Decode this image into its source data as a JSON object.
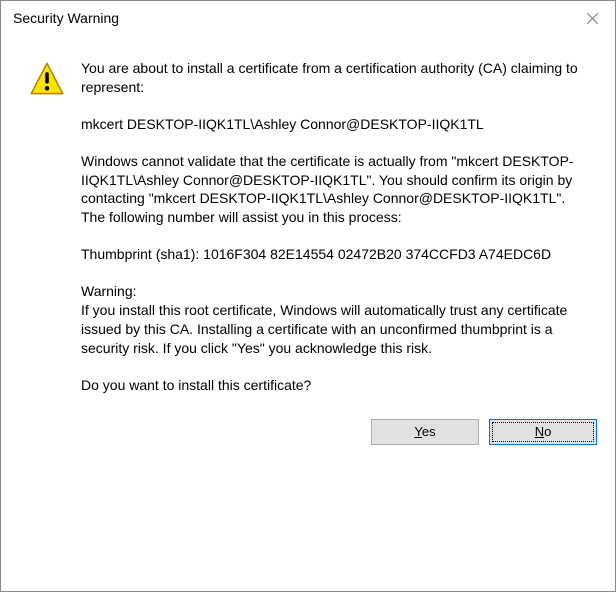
{
  "titlebar": {
    "title": "Security Warning"
  },
  "body": {
    "intro": "You are about to install a certificate from a certification authority (CA) claiming to represent:",
    "subject": "mkcert DESKTOP-IIQK1TL\\Ashley Connor@DESKTOP-IIQK1TL",
    "validate": "Windows cannot validate that the certificate is actually from \"mkcert DESKTOP-IIQK1TL\\Ashley Connor@DESKTOP-IIQK1TL\". You should confirm its origin by contacting \"mkcert DESKTOP-IIQK1TL\\Ashley Connor@DESKTOP-IIQK1TL\". The following number will assist you in this process:",
    "thumbprint": "Thumbprint (sha1): 1016F304 82E14554 02472B20 374CCFD3 A74EDC6D",
    "warning_label": "Warning:",
    "warning_text": "If you install this root certificate, Windows will automatically trust any certificate issued by this CA. Installing a certificate with an unconfirmed thumbprint is a security risk. If you click \"Yes\" you acknowledge this risk.",
    "question": "Do you want to install this certificate?"
  },
  "buttons": {
    "yes_mnemonic": "Y",
    "yes_rest": "es",
    "no_mnemonic": "N",
    "no_rest": "o"
  }
}
